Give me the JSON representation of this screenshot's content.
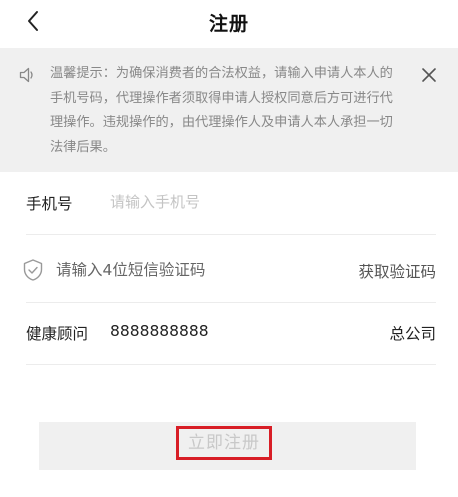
{
  "header": {
    "title": "注册",
    "back_icon": "chevron-left-icon"
  },
  "notice": {
    "icon": "speaker-icon",
    "text": "温馨提示：为确保消费者的合法权益，请输入申请人本人的手机号码，代理操作者须取得申请人授权同意后方可进行代理操作。违规操作的，由代理操作人及申请人本人承担一切法律后果。",
    "close_icon": "close-icon"
  },
  "form": {
    "phone": {
      "label": "手机号",
      "value": "",
      "placeholder": "请输入手机号"
    },
    "code": {
      "icon": "shield-check-icon",
      "value": "",
      "placeholder": "请输入4位短信验证码",
      "get_code_label": "获取验证码"
    },
    "advisor": {
      "label": "健康顾问",
      "value": "8888888888",
      "org": "总公司"
    }
  },
  "submit": {
    "label": "立即注册"
  },
  "colors": {
    "highlight_border": "#d81e26",
    "notice_background": "#f0f0f0",
    "button_background": "#f0f0f0"
  }
}
